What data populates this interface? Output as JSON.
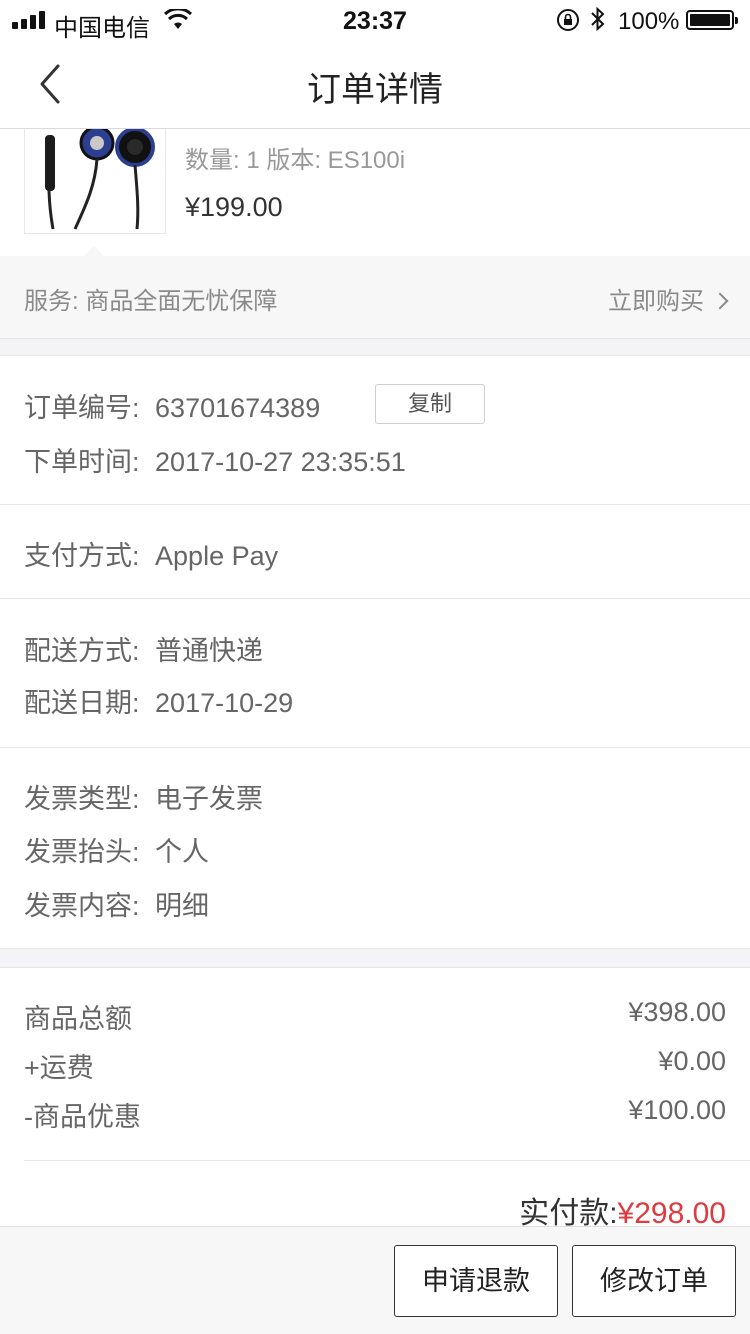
{
  "status_bar": {
    "carrier": "中国电信",
    "time": "23:37",
    "battery": "100%"
  },
  "nav": {
    "title": "订单详情"
  },
  "product": {
    "spec": "数量: 1 版本: ES100i",
    "price": "¥199.00"
  },
  "service": {
    "label": "服务:  商品全面无忧保障",
    "action": "立即购买"
  },
  "order": {
    "number_label": "订单编号:",
    "number": "63701674389",
    "copy_label": "复制",
    "time_label": "下单时间:",
    "time": "2017-10-27 23:35:51"
  },
  "payment": {
    "label": "支付方式:",
    "value": "Apple Pay"
  },
  "delivery": {
    "method_label": "配送方式:",
    "method": "普通快递",
    "date_label": "配送日期:",
    "date": "2017-10-29"
  },
  "invoice": {
    "type_label": "发票类型:",
    "type": "电子发票",
    "title_label": "发票抬头:",
    "title": "个人",
    "content_label": "发票内容:",
    "content": "明细"
  },
  "summary": {
    "goods_label": "商品总额",
    "goods_amount": "¥398.00",
    "shipping_label": "+运费",
    "shipping_amount": "¥0.00",
    "discount_label": "-商品优惠",
    "discount_amount": "¥100.00",
    "paid_label": "实付款:",
    "paid_amount": "¥298.00"
  },
  "actions": {
    "refund": "申请退款",
    "modify": "修改订单"
  },
  "colors": {
    "accent_red": "#e0393e",
    "gap_bg": "#f4f4f6"
  }
}
